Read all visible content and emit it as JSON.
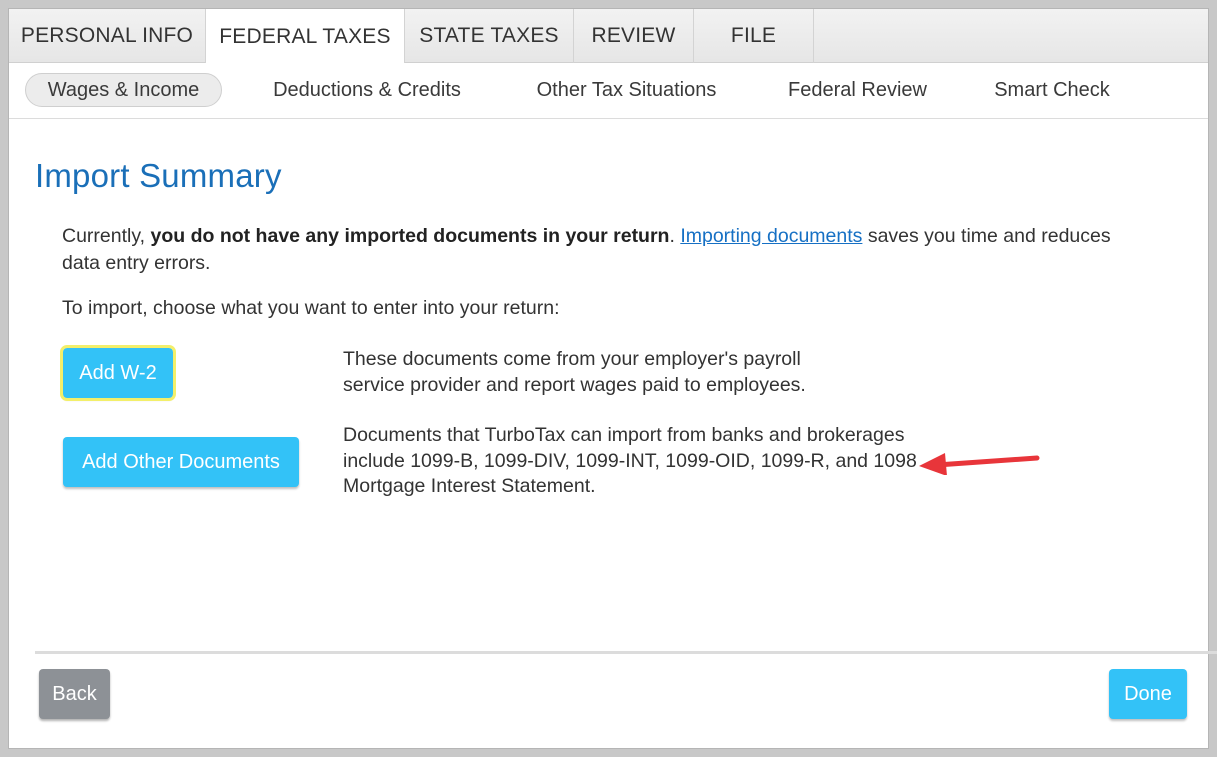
{
  "top_tabs": [
    {
      "label": "PERSONAL INFO"
    },
    {
      "label": "FEDERAL TAXES"
    },
    {
      "label": "STATE TAXES"
    },
    {
      "label": "REVIEW"
    },
    {
      "label": "FILE"
    }
  ],
  "active_top_tab": "FEDERAL TAXES",
  "sub_nav": [
    {
      "label": "Wages & Income"
    },
    {
      "label": "Deductions & Credits"
    },
    {
      "label": "Other Tax Situations"
    },
    {
      "label": "Federal Review"
    },
    {
      "label": "Smart Check"
    }
  ],
  "active_sub_nav": "Wages & Income",
  "main": {
    "title": "Import Summary",
    "intro_prefix": "Currently, ",
    "intro_bold": "you do not have any imported documents in your return",
    "intro_after_bold": ". ",
    "intro_link": "Importing documents",
    "intro_suffix": " saves you time and reduces data entry errors.",
    "choose_text": "To import, choose what you want to enter into your return:",
    "options": [
      {
        "button_label": "Add W-2",
        "description": "These documents come from your employer's payroll service provider and report wages paid to employees."
      },
      {
        "button_label": "Add Other Documents",
        "description": "Documents that TurboTax can import from banks and brokerages include 1099-B, 1099-DIV, 1099-INT, 1099-OID, 1099-R, and 1098 Mortgage Interest Statement."
      }
    ]
  },
  "footer": {
    "back_label": "Back",
    "done_label": "Done"
  },
  "colors": {
    "accent_blue": "#33c2f7",
    "title_blue": "#1a6fb8",
    "link_blue": "#1670c4",
    "annotation_arrow": "#e8353a",
    "focus_highlight": "#f3ef6a"
  }
}
